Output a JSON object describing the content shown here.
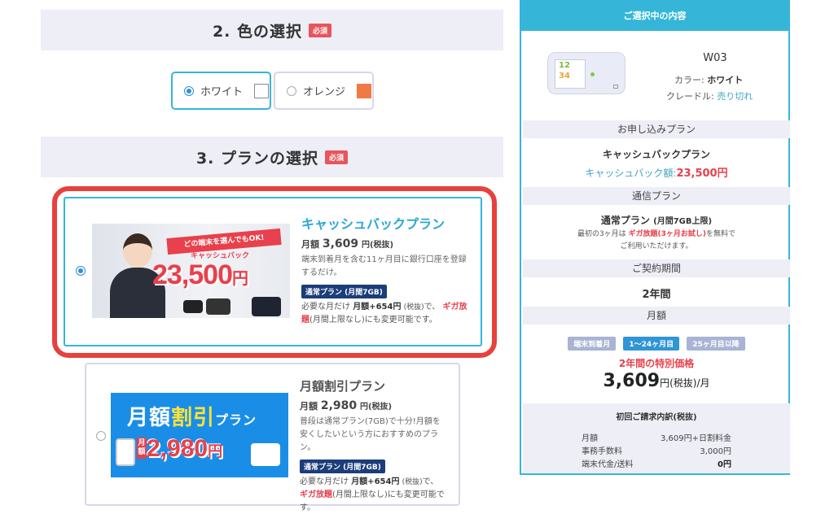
{
  "color_section": {
    "title": "2. 色の選択",
    "badge": "必須",
    "options": [
      {
        "label": "ホワイト",
        "swatch": "#ffffff",
        "selected": true
      },
      {
        "label": "オレンジ",
        "swatch": "#f07a45",
        "selected": false
      }
    ]
  },
  "plan_section": {
    "title": "3. プランの選択",
    "badge": "必須",
    "plans": [
      {
        "banner_ribbon": "どの端末を選んでもOK!",
        "banner_sub": "キャッシュバック",
        "banner_price": "23,500",
        "banner_yen": "円",
        "name": "キャッシュバックプラン",
        "monthly_label": "月額",
        "monthly_price": "3,609",
        "monthly_unit": "円(税抜)",
        "desc": "端末到着月を含む11ヶ月目に銀行口座を登録するだけ。",
        "tag": "通常プラン (月間7GB)",
        "note_a": "必要な月だけ",
        "note_b": "月額+654円",
        "note_c": "(税抜)",
        "note_d": "で、",
        "note_e": "ギガ放題",
        "note_f": "(月間上限なし)にも変更可能です。",
        "selected": true
      },
      {
        "banner_title_a": "月額",
        "banner_title_b": "割引",
        "banner_title_c": "プラン",
        "banner_left": "月額",
        "banner_price": "2,980",
        "banner_yen": "円",
        "name": "月額割引プラン",
        "monthly_label": "月額",
        "monthly_price": "2,980",
        "monthly_unit": "円(税抜)",
        "desc": "普段は通常プラン(7GB)で十分!月額を安くしたいという方におすすめのプラン。",
        "tag": "通常プラン (月間7GB)",
        "note_a": "必要な月だけ",
        "note_b": "月額+654円",
        "note_c": "(税抜)",
        "note_d": "で、",
        "note_e": "ギガ放題",
        "note_f": "(月間上限なし)にも変更可能です。",
        "selected": false
      }
    ]
  },
  "summary": {
    "header": "ご選択中の内容",
    "model": "W03",
    "color_label": "カラー:",
    "color_value": "ホワイト",
    "cradle_label": "クレードル:",
    "cradle_value": "売り切れ",
    "screen_line1": "12",
    "screen_line2": "34",
    "plan_section": "お申し込みプラン",
    "plan_name": "キャッシュバックプラン",
    "cashback_label": "キャッシュバック額:",
    "cashback_value": "23,500円",
    "comm_section": "通信プラン",
    "comm_name": "通常プラン",
    "comm_name_sub": "(月間7GB上限)",
    "comm_note_a": "最初の3ヶ月は",
    "comm_note_b": "ギガ放題(3ヶ月お試し)",
    "comm_note_c": "を無料で",
    "comm_note_d": "ご利用いただけます。",
    "term_section": "ご契約期間",
    "term_value": "2年間",
    "fee_section": "月額",
    "fee_tabs": [
      "端末到着月",
      "1〜24ヶ月目",
      "25ヶ月目以降"
    ],
    "fee_active_tab": 1,
    "special_label": "2年間の特別価格",
    "special_price": "3,609",
    "special_unit": "円(税抜)/月",
    "breakdown_title": "初回ご請求内訳(税抜)",
    "breakdown": [
      {
        "label": "月額",
        "value": "3,609円+日割料金"
      },
      {
        "label": "事務手数料",
        "value": "3,000円"
      },
      {
        "label": "端末代金/送料",
        "value": "0円"
      }
    ]
  },
  "colors": {
    "accent": "#35b6d8",
    "red": "#e8404c",
    "section_bg": "#eeeef7",
    "blue": "#2f95d6",
    "navy": "#1b3d7a"
  }
}
